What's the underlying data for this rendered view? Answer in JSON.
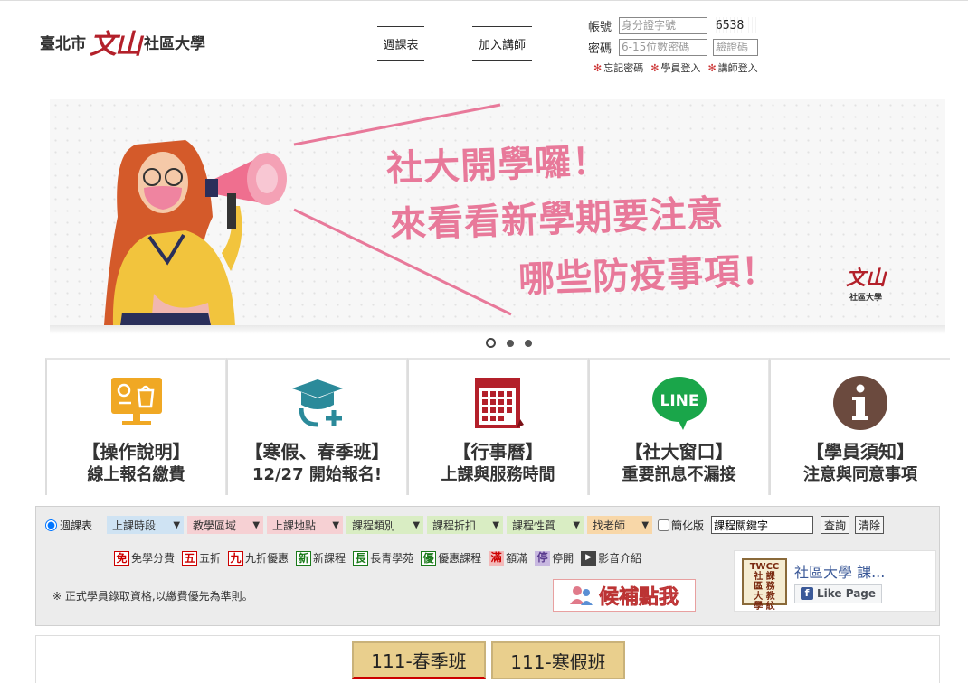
{
  "header": {
    "logo_city": "臺北市",
    "logo_mark": "文山",
    "logo_college": "社區大學",
    "nav": [
      {
        "label": "週課表"
      },
      {
        "label": "加入講師"
      }
    ],
    "login": {
      "account_label": "帳號",
      "account_placeholder": "身分證字號",
      "captcha_code": "6538",
      "password_label": "密碼",
      "password_placeholder": "6-15位數密碼",
      "captcha_placeholder": "驗證碼",
      "links": [
        "忘記密碼",
        "學員登入",
        "講師登入"
      ]
    }
  },
  "banner": {
    "line1": "社大開學囉！",
    "line2": "來看看新學期要注意",
    "line3": "哪些防疫事項！",
    "watermark_mark": "文山",
    "watermark_text": "社區大學",
    "slide_count": 3,
    "active_slide": 1,
    "accent_color": "#e8799a"
  },
  "tiles": [
    {
      "icon": "shopping-screen-icon",
      "title": "【操作說明】",
      "subtitle": "線上報名繳費",
      "color": "#f0a824"
    },
    {
      "icon": "graduate-add-icon",
      "title": "【寒假、春季班】",
      "subtitle": "12/27  開始報名!",
      "color": "#2b8a9a"
    },
    {
      "icon": "calendar-icon",
      "title": "【行事曆】",
      "subtitle": "上課與服務時間",
      "color": "#b3202a"
    },
    {
      "icon": "line-icon",
      "title": "【社大窗口】",
      "subtitle": "重要訊息不漏接",
      "color": "#1aa64a"
    },
    {
      "icon": "info-icon",
      "title": "【學員須知】",
      "subtitle": "注意與同意事項",
      "color": "#6b4a3e"
    }
  ],
  "filter": {
    "radio_label": "週課表",
    "selects": [
      {
        "label": "上課時段"
      },
      {
        "label": "教學區域"
      },
      {
        "label": "上課地點"
      },
      {
        "label": "課程類別"
      },
      {
        "label": "課程折扣"
      },
      {
        "label": "課程性質"
      },
      {
        "label": "找老師"
      }
    ],
    "simple_label": "簡化版",
    "keyword_value": "課程關鍵字",
    "search_button": "查詢",
    "clear_button": "清除",
    "legend": [
      {
        "mark": "免",
        "label": "免學分費"
      },
      {
        "mark": "五",
        "label": "五折"
      },
      {
        "mark": "九",
        "label": "九折優惠"
      },
      {
        "mark": "新",
        "label": "新課程"
      },
      {
        "mark": "長",
        "label": "長青學苑"
      },
      {
        "mark": "優",
        "label": "優惠課程"
      },
      {
        "mark": "滿",
        "label": "額滿"
      },
      {
        "mark": "停",
        "label": "停開"
      },
      {
        "mark": "▶",
        "label": "影音介紹"
      }
    ],
    "notice": "※ 正式學員錄取資格,以繳費優先為準則。",
    "waitlist_label": "候補點我",
    "facebook": {
      "page_name": "社區大學 課...",
      "like_label": "Like Page",
      "thumb_text": "TWCC\n社區大學\n務教紋"
    }
  },
  "terms": [
    {
      "label": "111-春季班"
    },
    {
      "label": "111-寒假班"
    }
  ]
}
